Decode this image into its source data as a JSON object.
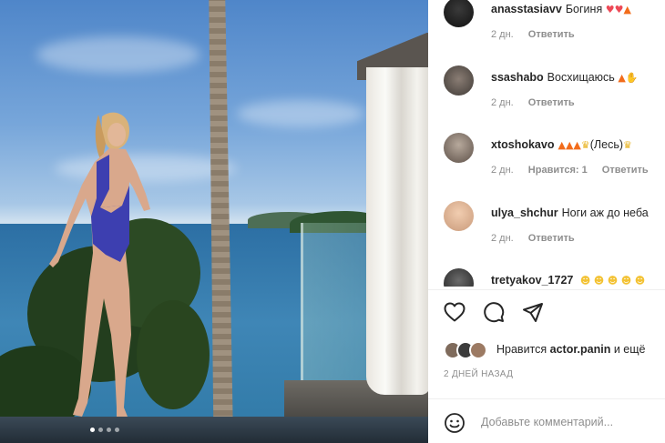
{
  "post": {
    "carousel": {
      "slides": 4,
      "active_index": 0
    }
  },
  "comments": [
    {
      "username": "anasstasiavv",
      "text": "Богиня",
      "emojis": [
        "heart",
        "heart",
        "fire"
      ],
      "time": "2 дн.",
      "reply_label": "Ответить",
      "likes_label": ""
    },
    {
      "username": "ssashabo",
      "text": "Восхищаюсь",
      "emojis": [
        "fire",
        "clap"
      ],
      "time": "2 дн.",
      "reply_label": "Ответить",
      "likes_label": ""
    },
    {
      "username": "xtoshokavo",
      "text": "(Лесь)",
      "emojis_before": [
        "fire",
        "fire",
        "fire",
        "crown"
      ],
      "emojis_after": [
        "crown"
      ],
      "time": "2 дн.",
      "likes_label": "Нравится: 1",
      "reply_label": "Ответить"
    },
    {
      "username": "ulya_shchur",
      "text": "Ноги аж до неба",
      "emojis": [],
      "time": "2 дн.",
      "reply_label": "Ответить",
      "likes_label": ""
    },
    {
      "username": "tretyakov_1727",
      "text": "",
      "emojis": [
        "face",
        "face",
        "face",
        "face",
        "face"
      ],
      "time": "",
      "reply_label": "",
      "likes_label": ""
    }
  ],
  "actions": {
    "like_icon": "heart-outline-icon",
    "comment_icon": "comment-bubble-icon",
    "share_icon": "paper-plane-icon"
  },
  "likes": {
    "prefix": "Нравится",
    "user": "actor.panin",
    "suffix": "и ещё"
  },
  "post_date": "2 ДНЕЙ НАЗАД",
  "add_comment": {
    "placeholder": "Добавьте комментарий..."
  },
  "colors": {
    "text": "#262626",
    "muted": "#8e8e8e",
    "divider": "#efefef",
    "heart_emoji": "#ed4956",
    "fire_emoji": "#f26c1b"
  }
}
